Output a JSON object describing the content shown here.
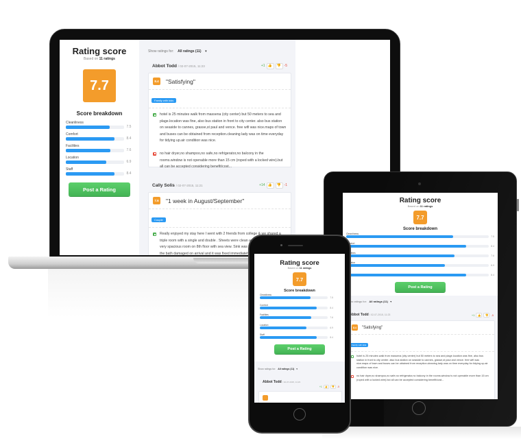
{
  "rating": {
    "title": "Rating score",
    "based_on_prefix": "Based on",
    "based_on_count": "11 ratings",
    "overall_score": "7.7",
    "breakdown_title": "Score breakdown",
    "categories": [
      {
        "label": "Cleanliness",
        "value": "7.5",
        "fraction": 0.75
      },
      {
        "label": "Comfort",
        "value": "8.4",
        "fraction": 0.84
      },
      {
        "label": "Facilities",
        "value": "7.6",
        "fraction": 0.76
      },
      {
        "label": "Location",
        "value": "6.9",
        "fraction": 0.69
      },
      {
        "label": "Staff",
        "value": "8.4",
        "fraction": 0.84
      }
    ],
    "post_button": "Post a Rating"
  },
  "filter": {
    "label": "Show ratings for:",
    "selected": "All ratings (11)",
    "caret": "▾"
  },
  "reviews": [
    {
      "author": "Abbot Todd",
      "date": "/ 02-07-2015, 11:23",
      "upvotes": "+1",
      "downvotes": "-5",
      "score": "8.4",
      "title": "\"Satisfying\"",
      "tag": "Family with kids",
      "pro": "hotel is 25 minutes walk from massena (city center) but 50 meters to sea and plage.location was fine, also bus station in front to city center. also bus station on seaside to cannes, grasse,st paul and vence. free wifi was nice.maps of town and buses can be obtained from reception.cleaning lady was on time everyday for tidying up.air condition was nice.",
      "con": "no hair dryer,no shampoo,no safe,no refrigerator,no balcony in the rooms.window is not openable more than 15 cm (roped with a locked wire).but all can be accepted considering benefit/cost..."
    },
    {
      "author": "Cally Solis",
      "date": "/ 02-07-2015, 11:21",
      "upvotes": "+14",
      "downvotes": "-1",
      "score": "7.6",
      "title": "\"1 week in August/September\"",
      "tag": "Couple",
      "pro": "Really enjoyed my stay here I went with 2 friends from college & we shared a triple room with a single and double . Sheets were clean and floor was spotless very spacious room on 8th floor with sea view. Sink was blocked and a panel in the bath damaged on arrival and it was fixed immediately ! There was also..."
    }
  ],
  "icons": {
    "thumbs_up": "👍",
    "thumbs_down": "👎"
  }
}
